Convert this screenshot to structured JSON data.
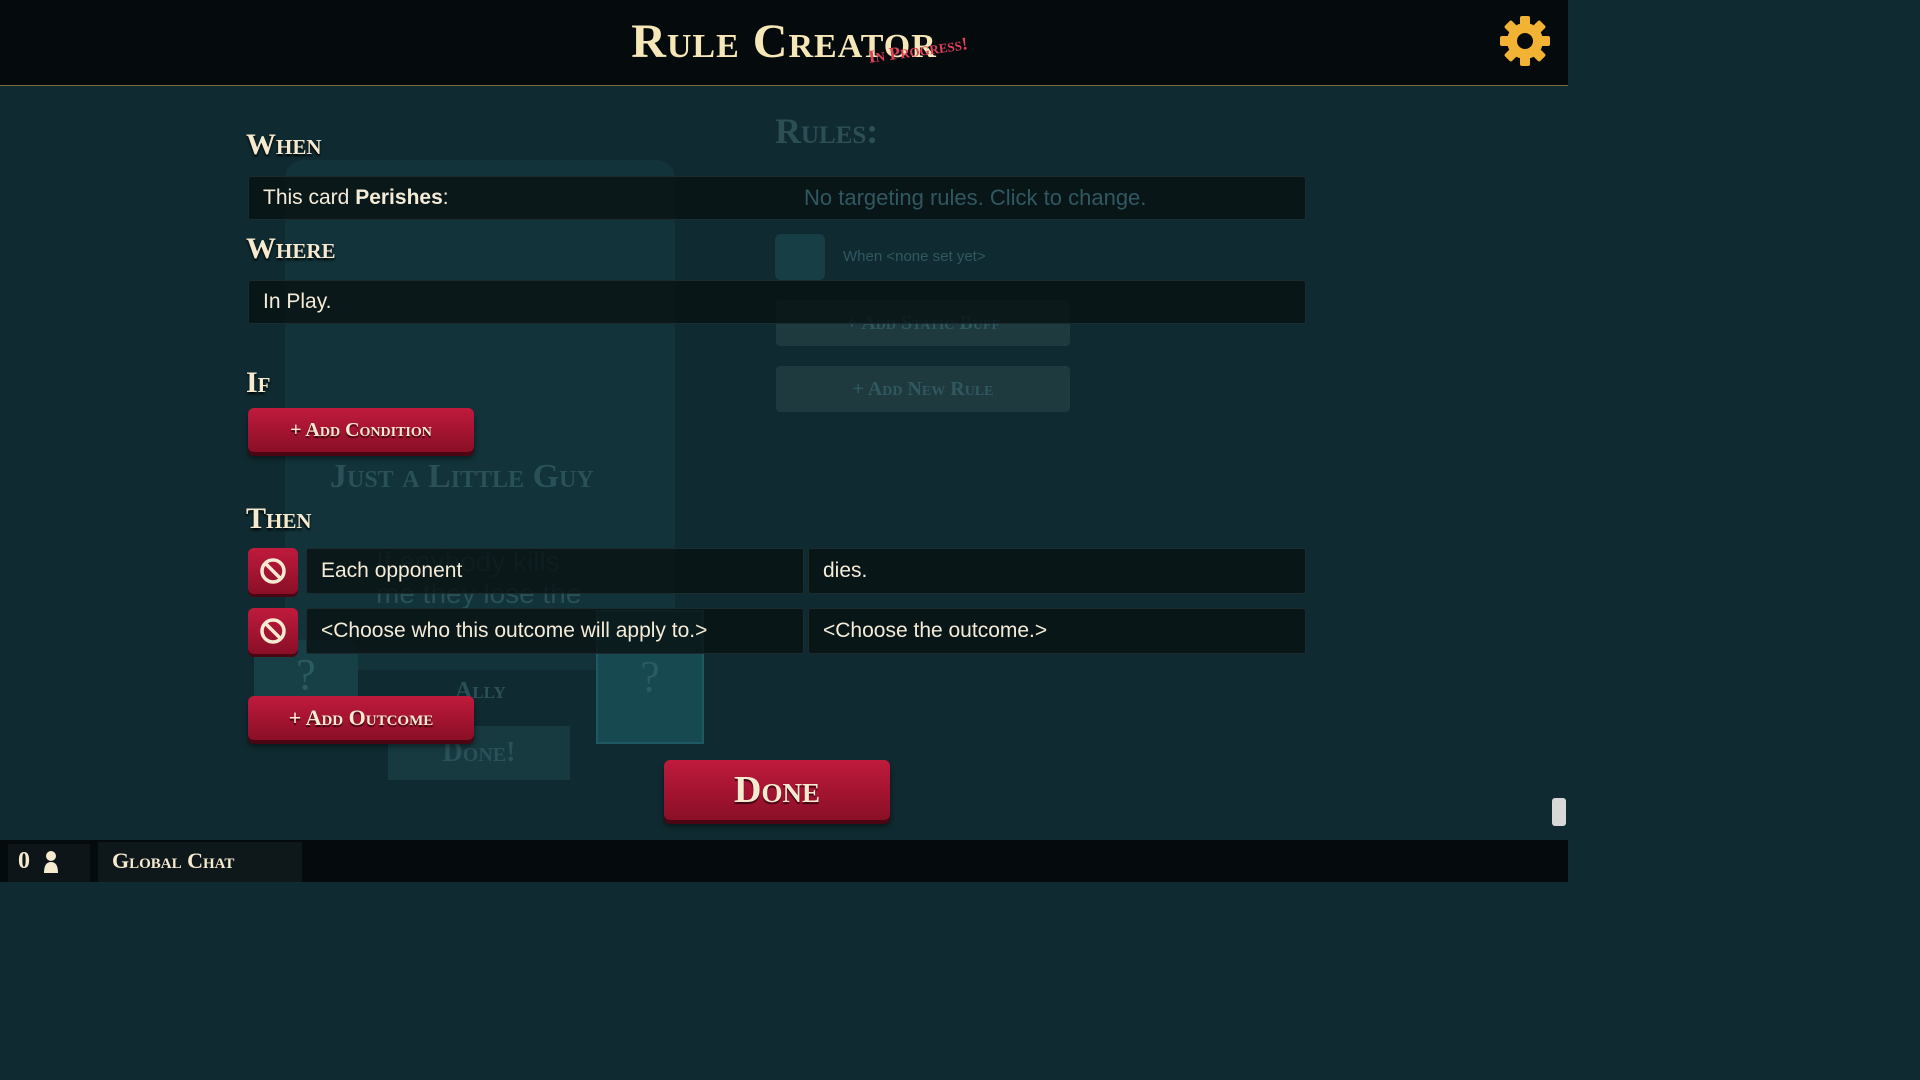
{
  "header": {
    "title": "Rule Creator",
    "subtitle": "In Progress!"
  },
  "background": {
    "card_name": "Just a Little Guy",
    "card_text": "If anybody kills me they lose the",
    "ally_label": "Ally",
    "card_done": "Done!",
    "rules_title": "Rules:",
    "targeting_text": "No targeting rules. Click to change.",
    "when_text": "When <none set yet>",
    "add_static_buff": "+ Add Static Buff",
    "add_new_rule": "+ Add New Rule",
    "question_mark": "?"
  },
  "when": {
    "label": "When",
    "text_prefix": "This card ",
    "text_bold": "Perishes",
    "text_suffix": ":"
  },
  "where": {
    "label": "Where",
    "text": "In Play."
  },
  "if": {
    "label": "If",
    "add_condition": "+ Add Condition"
  },
  "then": {
    "label": "Then",
    "outcomes": [
      {
        "target": "Each opponent",
        "effect": "dies."
      },
      {
        "target": "<Choose who this outcome will apply to.>",
        "effect": "<Choose the outcome.>"
      }
    ],
    "add_outcome": "+ Add Outcome"
  },
  "done_label": "Done",
  "footer": {
    "online_count": "0",
    "chat_label": "Global Chat"
  },
  "icons": {
    "settings": "gear-icon",
    "remove": "ban-icon",
    "user": "person-icon"
  },
  "colors": {
    "accent_red": "#b3163a",
    "gold": "#f2b233",
    "background": "#0f2a30"
  }
}
